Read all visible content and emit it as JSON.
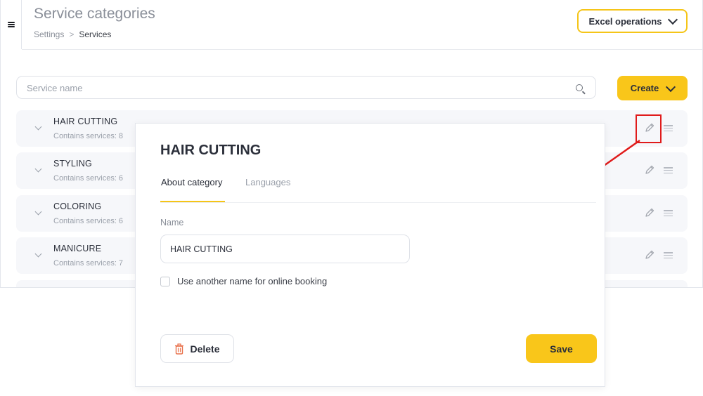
{
  "header": {
    "title": "Service categories",
    "breadcrumb": {
      "parent": "Settings",
      "separator": ">",
      "current": "Services"
    },
    "excel_button": "Excel operations"
  },
  "toolbar": {
    "search_placeholder": "Service name",
    "create_button": "Create"
  },
  "categories": [
    {
      "name": "HAIR CUTTING",
      "count": "Contains services: 8"
    },
    {
      "name": "STYLING",
      "count": "Contains services: 6"
    },
    {
      "name": "COLORING",
      "count": "Contains services: 6"
    },
    {
      "name": "MANICURE",
      "count": "Contains services: 7"
    }
  ],
  "modal": {
    "title": "HAIR CUTTING",
    "tabs": [
      {
        "label": "About category",
        "active": true
      },
      {
        "label": "Languages",
        "active": false
      }
    ],
    "name_label": "Name",
    "name_value": "HAIR CUTTING",
    "checkbox_label": "Use another name for online booking",
    "checkbox_checked": false,
    "delete_button": "Delete",
    "save_button": "Save"
  },
  "colors": {
    "accent": "#f9c61a",
    "annotation": "#e01b1b",
    "delete_icon": "#e8704a"
  },
  "icons": {
    "menu": "hamburger-icon",
    "search": "search-icon",
    "edit": "pencil-icon",
    "drag": "drag-handle-icon",
    "expand": "chevron-down-icon",
    "delete": "trash-icon"
  }
}
